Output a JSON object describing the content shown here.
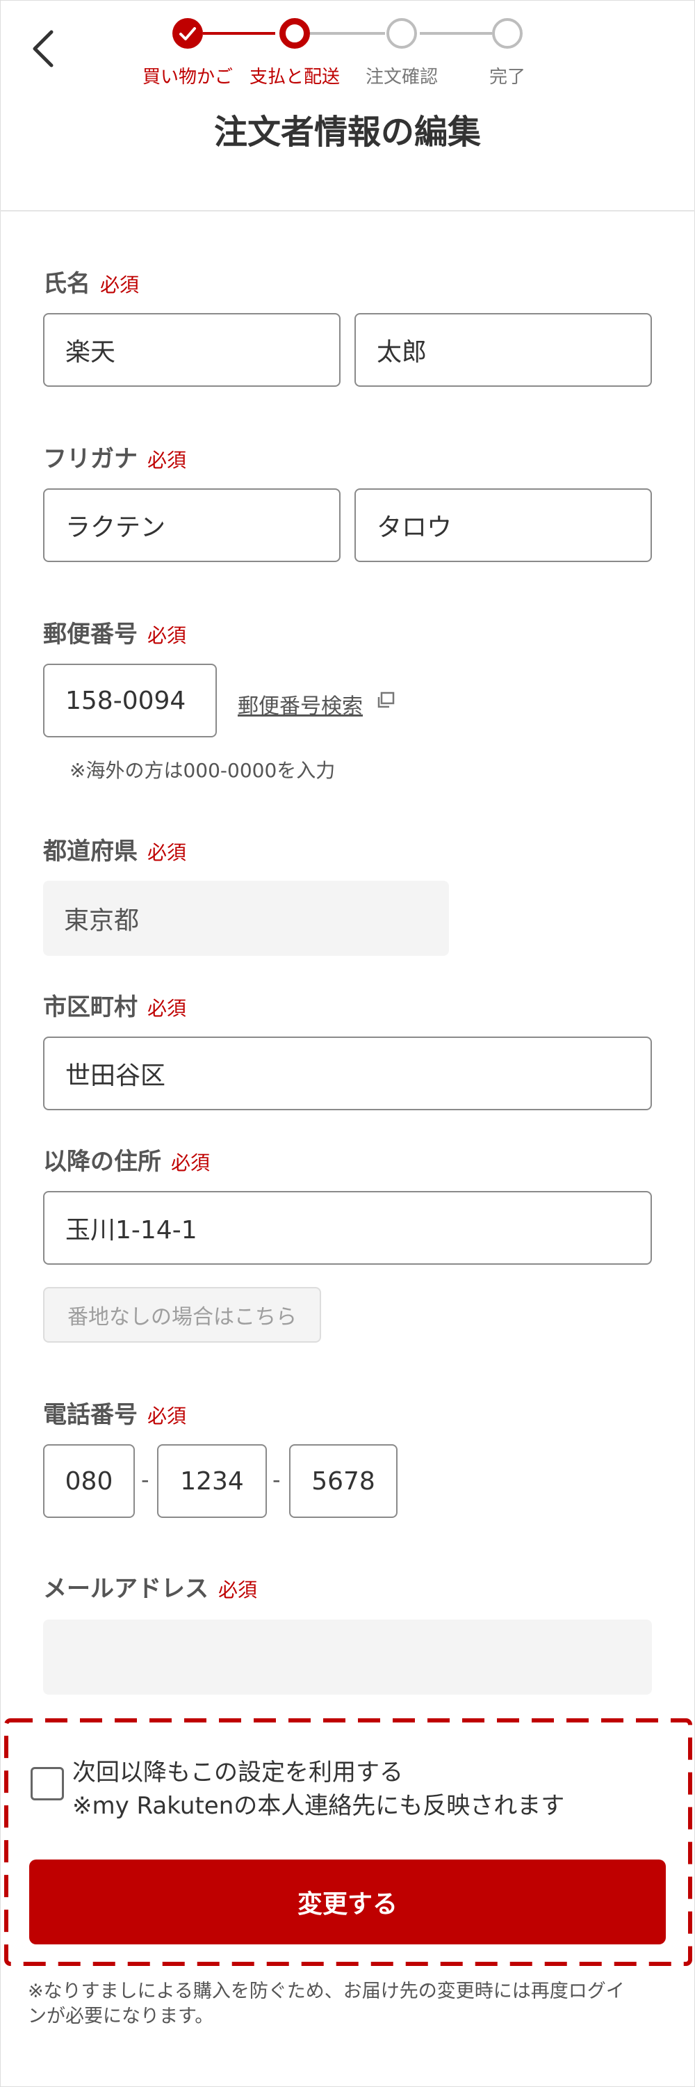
{
  "header": {
    "steps": [
      {
        "label": "買い物かご",
        "state": "done"
      },
      {
        "label": "支払と配送",
        "state": "current"
      },
      {
        "label": "注文確認",
        "state": "todo"
      },
      {
        "label": "完了",
        "state": "todo"
      }
    ],
    "title": "注文者情報の編集"
  },
  "required_label": "必須",
  "form": {
    "name": {
      "label": "氏名",
      "last": "楽天",
      "first": "太郎"
    },
    "kana": {
      "label": "フリガナ",
      "last": "ラクテン",
      "first": "タロウ"
    },
    "postal": {
      "label": "郵便番号",
      "value": "158-0094",
      "search_link": "郵便番号検索",
      "note": "※海外の方は000-0000を入力"
    },
    "prefecture": {
      "label": "都道府県",
      "value": "東京都"
    },
    "city": {
      "label": "市区町村",
      "value": "世田谷区"
    },
    "address": {
      "label": "以降の住所",
      "value": "玉川1-14-1",
      "no_number_button": "番地なしの場合はこちら"
    },
    "phone": {
      "label": "電話番号",
      "part1": "080",
      "part2": "1234",
      "part3": "5678",
      "separator": "-"
    },
    "email": {
      "label": "メールアドレス",
      "value": ""
    }
  },
  "save_setting": {
    "line1": "次回以降もこの設定を利用する",
    "line2": "※my Rakutenの本人連絡先にも反映されます",
    "checked": false
  },
  "submit_label": "変更する",
  "footnote": {
    "line1": "※なりすましによる購入を防ぐため、お届け先の変更時には再度ログイ",
    "line2": "ンが必要になります。"
  },
  "colors": {
    "accent": "#bf0000",
    "inactive": "#bdbdbd",
    "text": "#333333"
  }
}
